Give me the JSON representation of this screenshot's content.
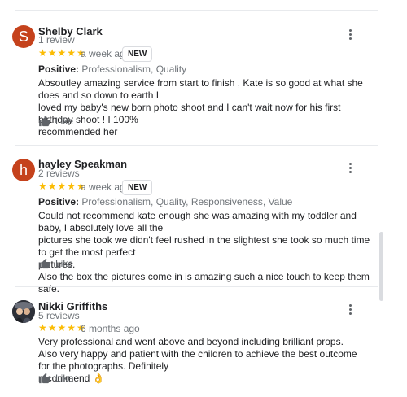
{
  "colors": {
    "shelby_avatar": "#c5421c",
    "hayley_avatar": "#c5421c",
    "stars": "#fbbc04"
  },
  "reviews": [
    {
      "avatar_letter": "S",
      "name": "Shelby Clark",
      "review_count": "1 review",
      "stars": "★★★★★",
      "rating": 5,
      "time": "a week ago",
      "badge": "NEW",
      "positive_label": "Positive:",
      "positive_values": " Professionalism, Quality",
      "text_lines": [
        "Absoutley amazing service from start to finish , Kate is so good at what she does and so down to earth I",
        "loved my baby's new born photo shoot and I can't wait now for his first birthday shoot ! I 100%",
        "recommended her"
      ],
      "like_label": "Like"
    },
    {
      "avatar_letter": "h",
      "name": "hayley Speakman",
      "review_count": "2 reviews",
      "stars": "★★★★★",
      "rating": 5,
      "time": "a week ago",
      "badge": "NEW",
      "positive_label": "Positive:",
      "positive_values": " Professionalism, Quality, Responsiveness, Value",
      "text_lines": [
        "Could not recommend kate enough she was amazing with my toddler and baby, I absolutely love all the",
        "pictures she took we didn't feel rushed in the slightest she took so much time to get the most perfect",
        "pictures.",
        "Also the box the pictures come in is amazing such a nice touch to keep them safe."
      ],
      "like_label": "Like"
    },
    {
      "name": "Nikki Griffiths",
      "review_count": "5 reviews",
      "stars": "★★★★★",
      "rating": 5,
      "time": "6 months ago",
      "text_lines": [
        "Very professional and went above and beyond including brilliant props.",
        "Also very happy and patient with the children to achieve the best outcome for the photographs. Definitely",
        "recommend 👌"
      ],
      "like_label": "Like"
    }
  ]
}
